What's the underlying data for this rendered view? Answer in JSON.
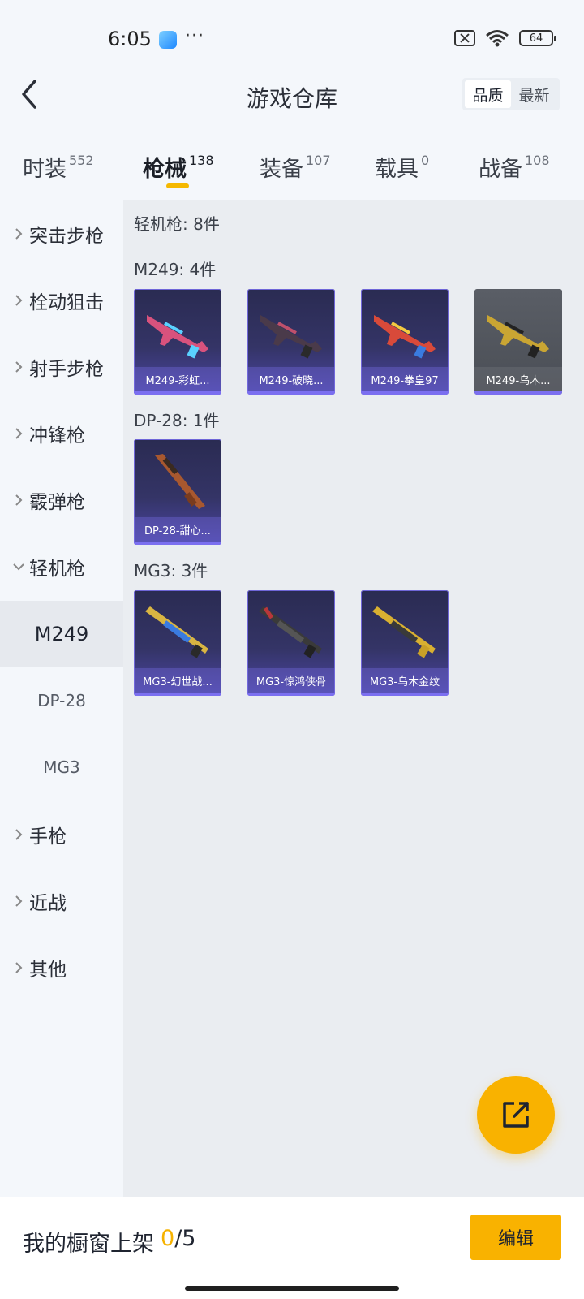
{
  "status_bar": {
    "time": "6:05",
    "battery": "64",
    "more": "···"
  },
  "header": {
    "title": "游戏仓库",
    "sort_options": [
      "品质",
      "最新"
    ]
  },
  "tabs": [
    {
      "label": "时装",
      "count": "552"
    },
    {
      "label": "枪械",
      "count": "138"
    },
    {
      "label": "装备",
      "count": "107"
    },
    {
      "label": "载具",
      "count": "0"
    },
    {
      "label": "战备",
      "count": "108"
    }
  ],
  "sidebar": {
    "categories": [
      {
        "label": "突击步枪"
      },
      {
        "label": "栓动狙击"
      },
      {
        "label": "射手步枪"
      },
      {
        "label": "冲锋枪"
      },
      {
        "label": "霰弹枪"
      },
      {
        "label": "轻机枪"
      },
      {
        "label": "手枪"
      },
      {
        "label": "近战"
      },
      {
        "label": "其他"
      }
    ],
    "subitems": [
      {
        "label": "M249"
      },
      {
        "label": "DP-28"
      },
      {
        "label": "MG3"
      }
    ]
  },
  "content": {
    "category_summary": "轻机枪: 8件",
    "groups": [
      {
        "title": "M249: 4件",
        "items": [
          {
            "name": "M249-彩虹...",
            "color": "#d8527d"
          },
          {
            "name": "M249-破晓...",
            "color": "#8a4a6a"
          },
          {
            "name": "M249-拳皇97",
            "color": "#d84a3a"
          },
          {
            "name": "M249-乌木...",
            "color": "#c9a533"
          }
        ]
      },
      {
        "title": "DP-28: 1件",
        "items": [
          {
            "name": "DP-28-甜心...",
            "color": "#a8582f"
          }
        ]
      },
      {
        "title": "MG3: 3件",
        "items": [
          {
            "name": "MG3-幻世战...",
            "color": "#d9b542"
          },
          {
            "name": "MG3-惊鸿侠骨",
            "color": "#b8373a"
          },
          {
            "name": "MG3-乌木金纹",
            "color": "#d9b031"
          }
        ]
      }
    ]
  },
  "bottom_bar": {
    "label": "我的橱窗上架",
    "count": "0",
    "max": "/5",
    "edit_label": "编辑"
  },
  "colors": {
    "accent": "#f9b200",
    "card_purple": "#4b46a4"
  }
}
